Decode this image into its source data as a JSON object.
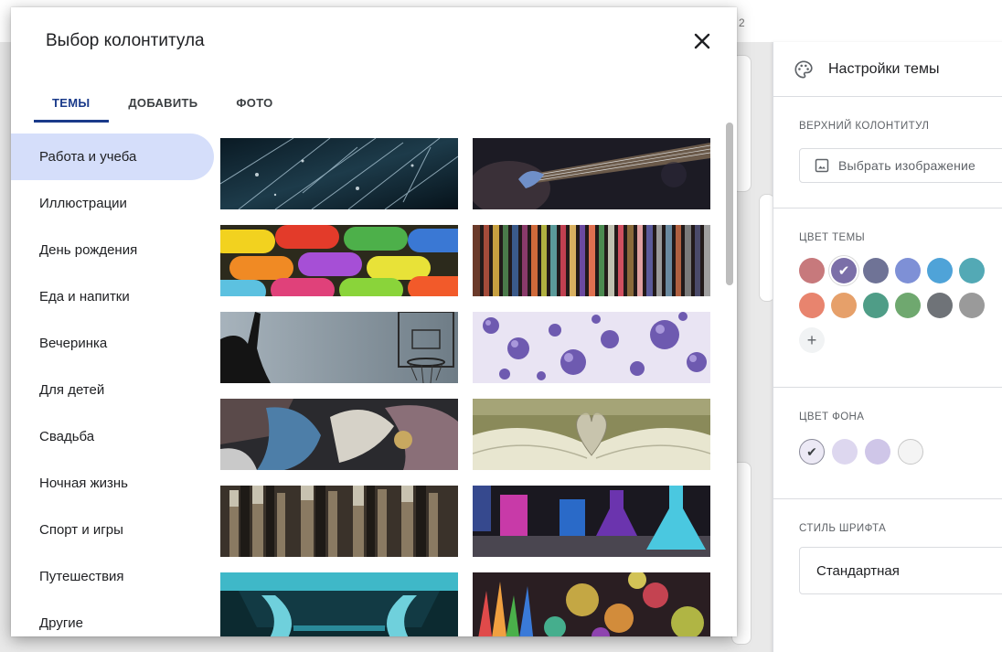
{
  "background": {
    "top_number": "2"
  },
  "dialog": {
    "title": "Выбор колонтитула",
    "tabs": [
      {
        "label": "ТЕМЫ",
        "active": true
      },
      {
        "label": "ДОБАВИТЬ",
        "active": false
      },
      {
        "label": "ФОТО",
        "active": false
      }
    ],
    "categories": [
      {
        "label": "Работа и учеба",
        "active": true
      },
      {
        "label": "Иллюстрации"
      },
      {
        "label": "День рождения"
      },
      {
        "label": "Еда и напитки"
      },
      {
        "label": "Вечеринка"
      },
      {
        "label": "Для детей"
      },
      {
        "label": "Свадьба"
      },
      {
        "label": "Ночная жизнь"
      },
      {
        "label": "Спорт и игры"
      },
      {
        "label": "Путешествия"
      },
      {
        "label": "Другие"
      }
    ],
    "thumbnails": [
      "rain-streaks-image",
      "guitar-image",
      "colorful-pills-image",
      "colored-pencils-image",
      "basketball-hoop-image",
      "purple-bubbles-image",
      "paint-hands-image",
      "book-heart-image",
      "paint-brushes-image",
      "lab-flasks-image",
      "microscope-image",
      "bokeh-pencils-image"
    ]
  },
  "theme_panel": {
    "title": "Настройки темы",
    "header_section": {
      "label": "ВЕРХНИЙ КОЛОНТИТУЛ",
      "button_label": "Выбрать изображение"
    },
    "theme_color": {
      "label": "ЦВЕТ ТЕМЫ",
      "colors": [
        "#c7797c",
        "#7b6fa8",
        "#6f7396",
        "#7e90d6",
        "#4fa3d8",
        "#53a9b5",
        "#e8846e",
        "#e6a06a",
        "#4f9d87",
        "#6fa86f",
        "#6f7378",
        "#9a9a9a"
      ],
      "selected_index": 1
    },
    "background_color": {
      "label": "ЦВЕТ ФОНА",
      "colors": [
        "#ece9f5",
        "#ddd7ef",
        "#cfc6e8",
        "#f4f4f4"
      ],
      "selected_index": 0
    },
    "font_style": {
      "label": "СТИЛЬ ШРИФТА",
      "value": "Стандартная"
    }
  }
}
